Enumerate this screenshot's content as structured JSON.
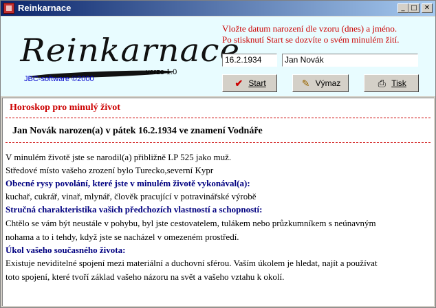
{
  "window": {
    "title": "Reinkarnace",
    "controls": {
      "minimize": "_",
      "maximize": "□",
      "close": "✕"
    }
  },
  "header": {
    "logo_text": "Reinkarnace",
    "version": "verze 1.0",
    "copyright": "JBC-software ©2000",
    "instructions": [
      "Vložte datum narození dle vzoru (dnes) a jméno.",
      "Po stisknutí Start se dozvíte o svém minulém žití."
    ],
    "date_input": "16.2.1934",
    "name_input": "Jan Novák",
    "buttons": {
      "start": "Start",
      "clear": "Výmaz",
      "print": "Tisk"
    }
  },
  "content": {
    "title": "Horoskop pro minulý život",
    "person_line": "Jan Novák narozen(a) v pátek 16.2.1934 ve znamení Vodnáře",
    "lines": [
      {
        "text": "V minulém životě jste se narodil(a) přibližně LP 525 jako muž.",
        "heading": false
      },
      {
        "text": "Středové místo vašeho zrození  bylo Turecko,severní Kypr",
        "heading": false
      },
      {
        "text": "Obecné rysy povolání, které jste v minulém životě vykonával(a):",
        "heading": true
      },
      {
        "text": "kuchař, cukrář, vinař, mlynář, člověk pracující v potravinářské výrobě",
        "heading": false
      },
      {
        "text": "Stručná charakteristika vašich předchozích vlastností a schopností:",
        "heading": true
      },
      {
        "text": "Chtělo se vám být neustále v pohybu, byl jste cestovatelem, tulákem nebo průzkumníkem s neúnavným",
        "heading": false
      },
      {
        "text": "nohama a to i tehdy, když jste se nacházel v omezeném prostředí.",
        "heading": false
      },
      {
        "text": "Úkol vašeho současného života:",
        "heading": true
      },
      {
        "text": "Existuje neviditelné spojení mezi materiální a duchovní sférou. Vaším úkolem je hledat, najít a používat",
        "heading": false
      },
      {
        "text": "toto spojení, které tvoří základ vašeho názoru na svět a vašeho vztahu k okolí.",
        "heading": false
      }
    ]
  },
  "icons": {
    "start": "checkmark-icon",
    "clear": "eraser-icon",
    "print": "printer-icon"
  },
  "colors": {
    "title_gradient_start": "#0a246a",
    "header_bg": "#e8fcff",
    "instruction_red": "#cc0000",
    "heading_blue": "#000080"
  }
}
